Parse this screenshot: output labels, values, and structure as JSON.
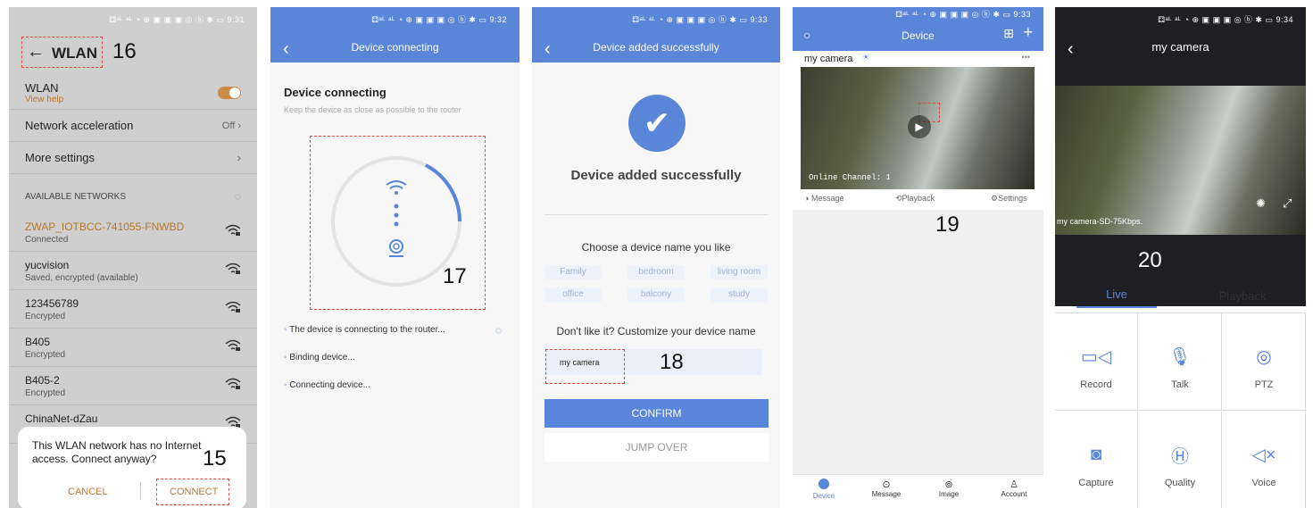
{
  "p1": {
    "status_time": "⚃ᵃᴸ ᵃᴸ ◔ ⊕ ▣ ▣ ▣  ◎ ⓑ ✱ ▭ 9:31",
    "back": "←",
    "title": "WLAN",
    "step": "16",
    "wlan": "WLAN",
    "view_help": "View help",
    "net_acc": "Network acceleration",
    "net_acc_val": "Off",
    "more": "More settings",
    "avail": "AVAILABLE NETWORKS",
    "networks": [
      {
        "name": "ZWAP_IOTBCC-741055-FNWBD",
        "status": "Connected"
      },
      {
        "name": "yucvision",
        "status": "Saved, encrypted (available)"
      },
      {
        "name": "123456789",
        "status": "Encrypted"
      },
      {
        "name": "B405",
        "status": "Encrypted"
      },
      {
        "name": "B405-2",
        "status": "Encrypted"
      },
      {
        "name": "ChinaNet-dZau",
        "status": "Encrypted"
      }
    ],
    "dialog_text": "This WLAN network has no Internet access. Connect anyway?",
    "step15": "15",
    "cancel": "CANCEL",
    "connect": "CONNECT",
    "colors": {
      "accent": "#c98a4a"
    }
  },
  "p2": {
    "status_time": "⚃ᵃᴸ ᵃᴸ ◔ ⊕ ▣ ▣ ▣  ◎ ⓑ ✱ ▭ 9:32",
    "title": "Device connecting",
    "heading": "Device connecting",
    "sub": "Keep the device as close as possible to the router",
    "step": "17",
    "steps": [
      "The device is connecting to the router...",
      "Binding device...",
      "Connecting device..."
    ]
  },
  "p3": {
    "status_time": "⚃ᵃᴸ ᵃᴸ ◔ ⊕ ▣ ▣ ▣  ◎ ⓑ ✱ ▭ 9:33",
    "title": "Device added successfully",
    "msg": "Device added successfully",
    "choose": "Choose a device name you like",
    "names": [
      "Family",
      "bedroom",
      "living room",
      "office",
      "balcony",
      "study"
    ],
    "custom": "Don't like it? Customize your device name",
    "value": "my camera",
    "step": "18",
    "confirm": "CONFIRM",
    "jump": "JUMP OVER"
  },
  "p4": {
    "status_time": "⚃ᵃᴸ ᵃᴸ ◔ ⊕ ▣ ▣ ▣  ◎ ⓑ ✱ ▭ 9:33",
    "title": "Device",
    "cam": "my camera",
    "more": "•••",
    "online": "Online  Channel: 1",
    "message": "Message",
    "playback": "Playback",
    "settings": "Settings",
    "step": "19",
    "tabs": [
      "Device",
      "Message",
      "Image",
      "Account"
    ]
  },
  "p5": {
    "status_time": "⚃ᵃᴸ ᵃᴸ ◔ ⊕ ▣ ▣ ▣  ◎ ⓑ ✱ ▭ 9:34",
    "title": "my camera",
    "overlay": "my camera-SD-75Kbps.",
    "step": "20",
    "live": "Live",
    "playback": "Playback",
    "cells": [
      "Record",
      "Talk",
      "PTZ",
      "Capture",
      "Quality",
      "Voice"
    ]
  }
}
